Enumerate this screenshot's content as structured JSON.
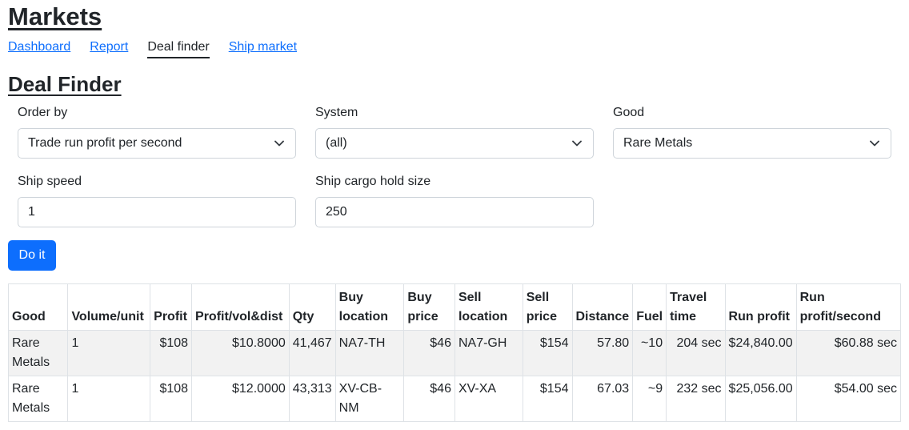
{
  "header": {
    "title": "Markets"
  },
  "nav": {
    "items": [
      {
        "label": "Dashboard"
      },
      {
        "label": "Report"
      },
      {
        "label": "Deal finder"
      },
      {
        "label": "Ship market"
      }
    ]
  },
  "section": {
    "title": "Deal Finder"
  },
  "form": {
    "order_by": {
      "label": "Order by",
      "value": "Trade run profit per second"
    },
    "system": {
      "label": "System",
      "value": "(all)"
    },
    "good": {
      "label": "Good",
      "value": "Rare Metals"
    },
    "ship_speed": {
      "label": "Ship speed",
      "value": "1"
    },
    "cargo_hold": {
      "label": "Ship cargo hold size",
      "value": "250"
    },
    "submit_label": "Do it"
  },
  "table": {
    "headers": [
      "Good",
      "Volume/unit",
      "Profit",
      "Profit/vol&dist",
      "Qty",
      "Buy location",
      "Buy price",
      "Sell location",
      "Sell price",
      "Distance",
      "Fuel",
      "Travel time",
      "Run profit",
      "Run profit/second"
    ],
    "rows": [
      [
        "Rare Metals",
        "1",
        "$108",
        "$10.8000",
        "41,467",
        "NA7-TH",
        "$46",
        "NA7-GH",
        "$154",
        "57.80",
        "~10",
        "204 sec",
        "$24,840.00",
        "$60.88 sec"
      ],
      [
        "Rare Metals",
        "1",
        "$108",
        "$12.0000",
        "43,313",
        "XV-CB-NM",
        "$46",
        "XV-XA",
        "$154",
        "67.03",
        "~9",
        "232 sec",
        "$25,056.00",
        "$54.00 sec"
      ]
    ]
  },
  "icons": {
    "select_chevron": "chevron-down-icon"
  },
  "colors": {
    "primary": "#0d6efd",
    "stripe": "#f2f2f2"
  }
}
